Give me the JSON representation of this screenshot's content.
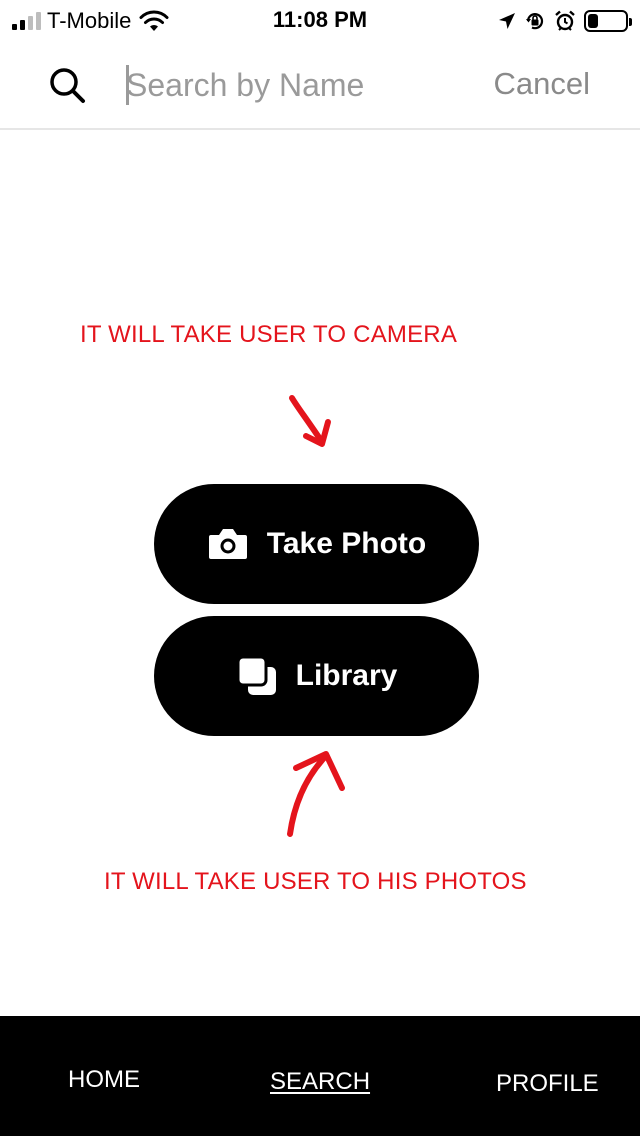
{
  "status_bar": {
    "carrier": "T-Mobile",
    "time": "11:08 PM",
    "signal_bars_filled": 2,
    "signal_bars_total": 4,
    "battery_level": 0.35,
    "icons": [
      "signal-icon",
      "wifi-icon",
      "location-icon",
      "orientation-lock-icon",
      "alarm-icon",
      "battery-icon"
    ]
  },
  "search": {
    "placeholder": "Search by Name",
    "value": "",
    "cancel_label": "Cancel",
    "icon": "search-icon"
  },
  "annotations": {
    "top_note": "IT WILL TAKE USER TO CAMERA",
    "bottom_note": "IT WILL TAKE USER TO HIS PHOTOS",
    "color": "#e4141c"
  },
  "actions": {
    "take_photo": {
      "label": "Take Photo",
      "icon": "camera-icon"
    },
    "library": {
      "label": "Library",
      "icon": "library-icon"
    }
  },
  "tab_bar": {
    "tabs": [
      {
        "label": "HOME"
      },
      {
        "label": "SEARCH",
        "active": true
      },
      {
        "label": "PROFILE"
      }
    ]
  }
}
